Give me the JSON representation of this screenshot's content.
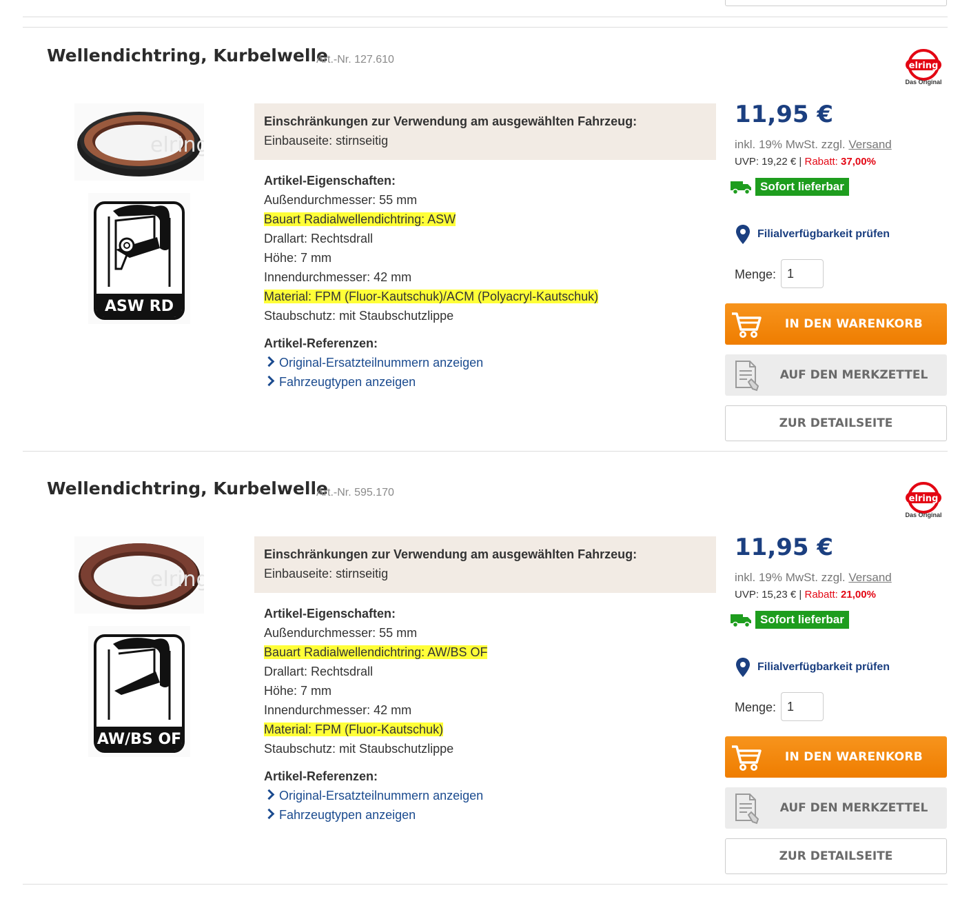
{
  "colors": {
    "price": "#1b3f80",
    "cart_button": "#f7941d",
    "available": "#1e9d1e",
    "highlight": "#ffff38",
    "link": "#1b4b8f",
    "discount": "#e30613"
  },
  "products": [
    {
      "title": "Wellendichtring, Kurbelwelle",
      "art_nr": "Art.-Nr. 127.610",
      "brand_logo": "elring",
      "brand_tagline": "Das Original",
      "seal_color": "#9a5a3e",
      "section_label": "ASW RD",
      "restriction_title": "Einschränkungen zur Verwendung am ausgewählten Fahrzeug:",
      "restriction_value": "Einbauseite: stirnseitig",
      "props_title": "Artikel-Eigenschaften:",
      "props": [
        "Außendurchmesser: 55 mm",
        "Bauart Radialwellendichtring: ASW",
        "Drallart: Rechtsdrall",
        "Höhe: 7 mm",
        "Innendurchmesser: 42 mm",
        "Material: FPM (Fluor-Kautschuk)/ACM (Polyacryl-Kautschuk)",
        "Staubschutz: mit Staubschutzlippe"
      ],
      "refs_title": "Artikel-Referenzen:",
      "refs": [
        "Original-Ersatzteilnummern anzeigen",
        "Fahrzeugtypen anzeigen"
      ],
      "price": "11,95 €",
      "tax_prefix": "inkl. 19% MwSt. zzgl.",
      "tax_link": "Versand",
      "uvp": "UVP: 19,22 €",
      "uvp_sep": "|",
      "rabatt_label": "Rabatt:",
      "rabatt_value": "37,00%",
      "availability": "Sofort lieferbar",
      "branch_check": "Filialverfügbarkeit prüfen",
      "qty_label": "Menge:",
      "qty_value": "1",
      "cart_label": "IN DEN WARENKORB",
      "memo_label": "AUF DEN MERKZETTEL",
      "detail_label": "ZUR DETAILSEITE"
    },
    {
      "title": "Wellendichtring, Kurbelwelle",
      "art_nr": "Art.-Nr. 595.170",
      "brand_logo": "elring",
      "brand_tagline": "Das Original",
      "seal_color": "#7a3f32",
      "section_label": "AW/BS OF",
      "restriction_title": "Einschränkungen zur Verwendung am ausgewählten Fahrzeug:",
      "restriction_value": "Einbauseite: stirnseitig",
      "props_title": "Artikel-Eigenschaften:",
      "props": [
        "Außendurchmesser: 55 mm",
        "Bauart Radialwellendichtring: AW/BS OF",
        "Drallart: Rechtsdrall",
        "Höhe: 7 mm",
        "Innendurchmesser: 42 mm",
        "Material: FPM (Fluor-Kautschuk)",
        "Staubschutz: mit Staubschutzlippe"
      ],
      "refs_title": "Artikel-Referenzen:",
      "refs": [
        "Original-Ersatzteilnummern anzeigen",
        "Fahrzeugtypen anzeigen"
      ],
      "price": "11,95 €",
      "tax_prefix": "inkl. 19% MwSt. zzgl.",
      "tax_link": "Versand",
      "uvp": "UVP: 15,23 €",
      "uvp_sep": "|",
      "rabatt_label": "Rabatt:",
      "rabatt_value": "21,00%",
      "availability": "Sofort lieferbar",
      "branch_check": "Filialverfügbarkeit prüfen",
      "qty_label": "Menge:",
      "qty_value": "1",
      "cart_label": "IN DEN WARENKORB",
      "memo_label": "AUF DEN MERKZETTEL",
      "detail_label": "ZUR DETAILSEITE"
    }
  ]
}
